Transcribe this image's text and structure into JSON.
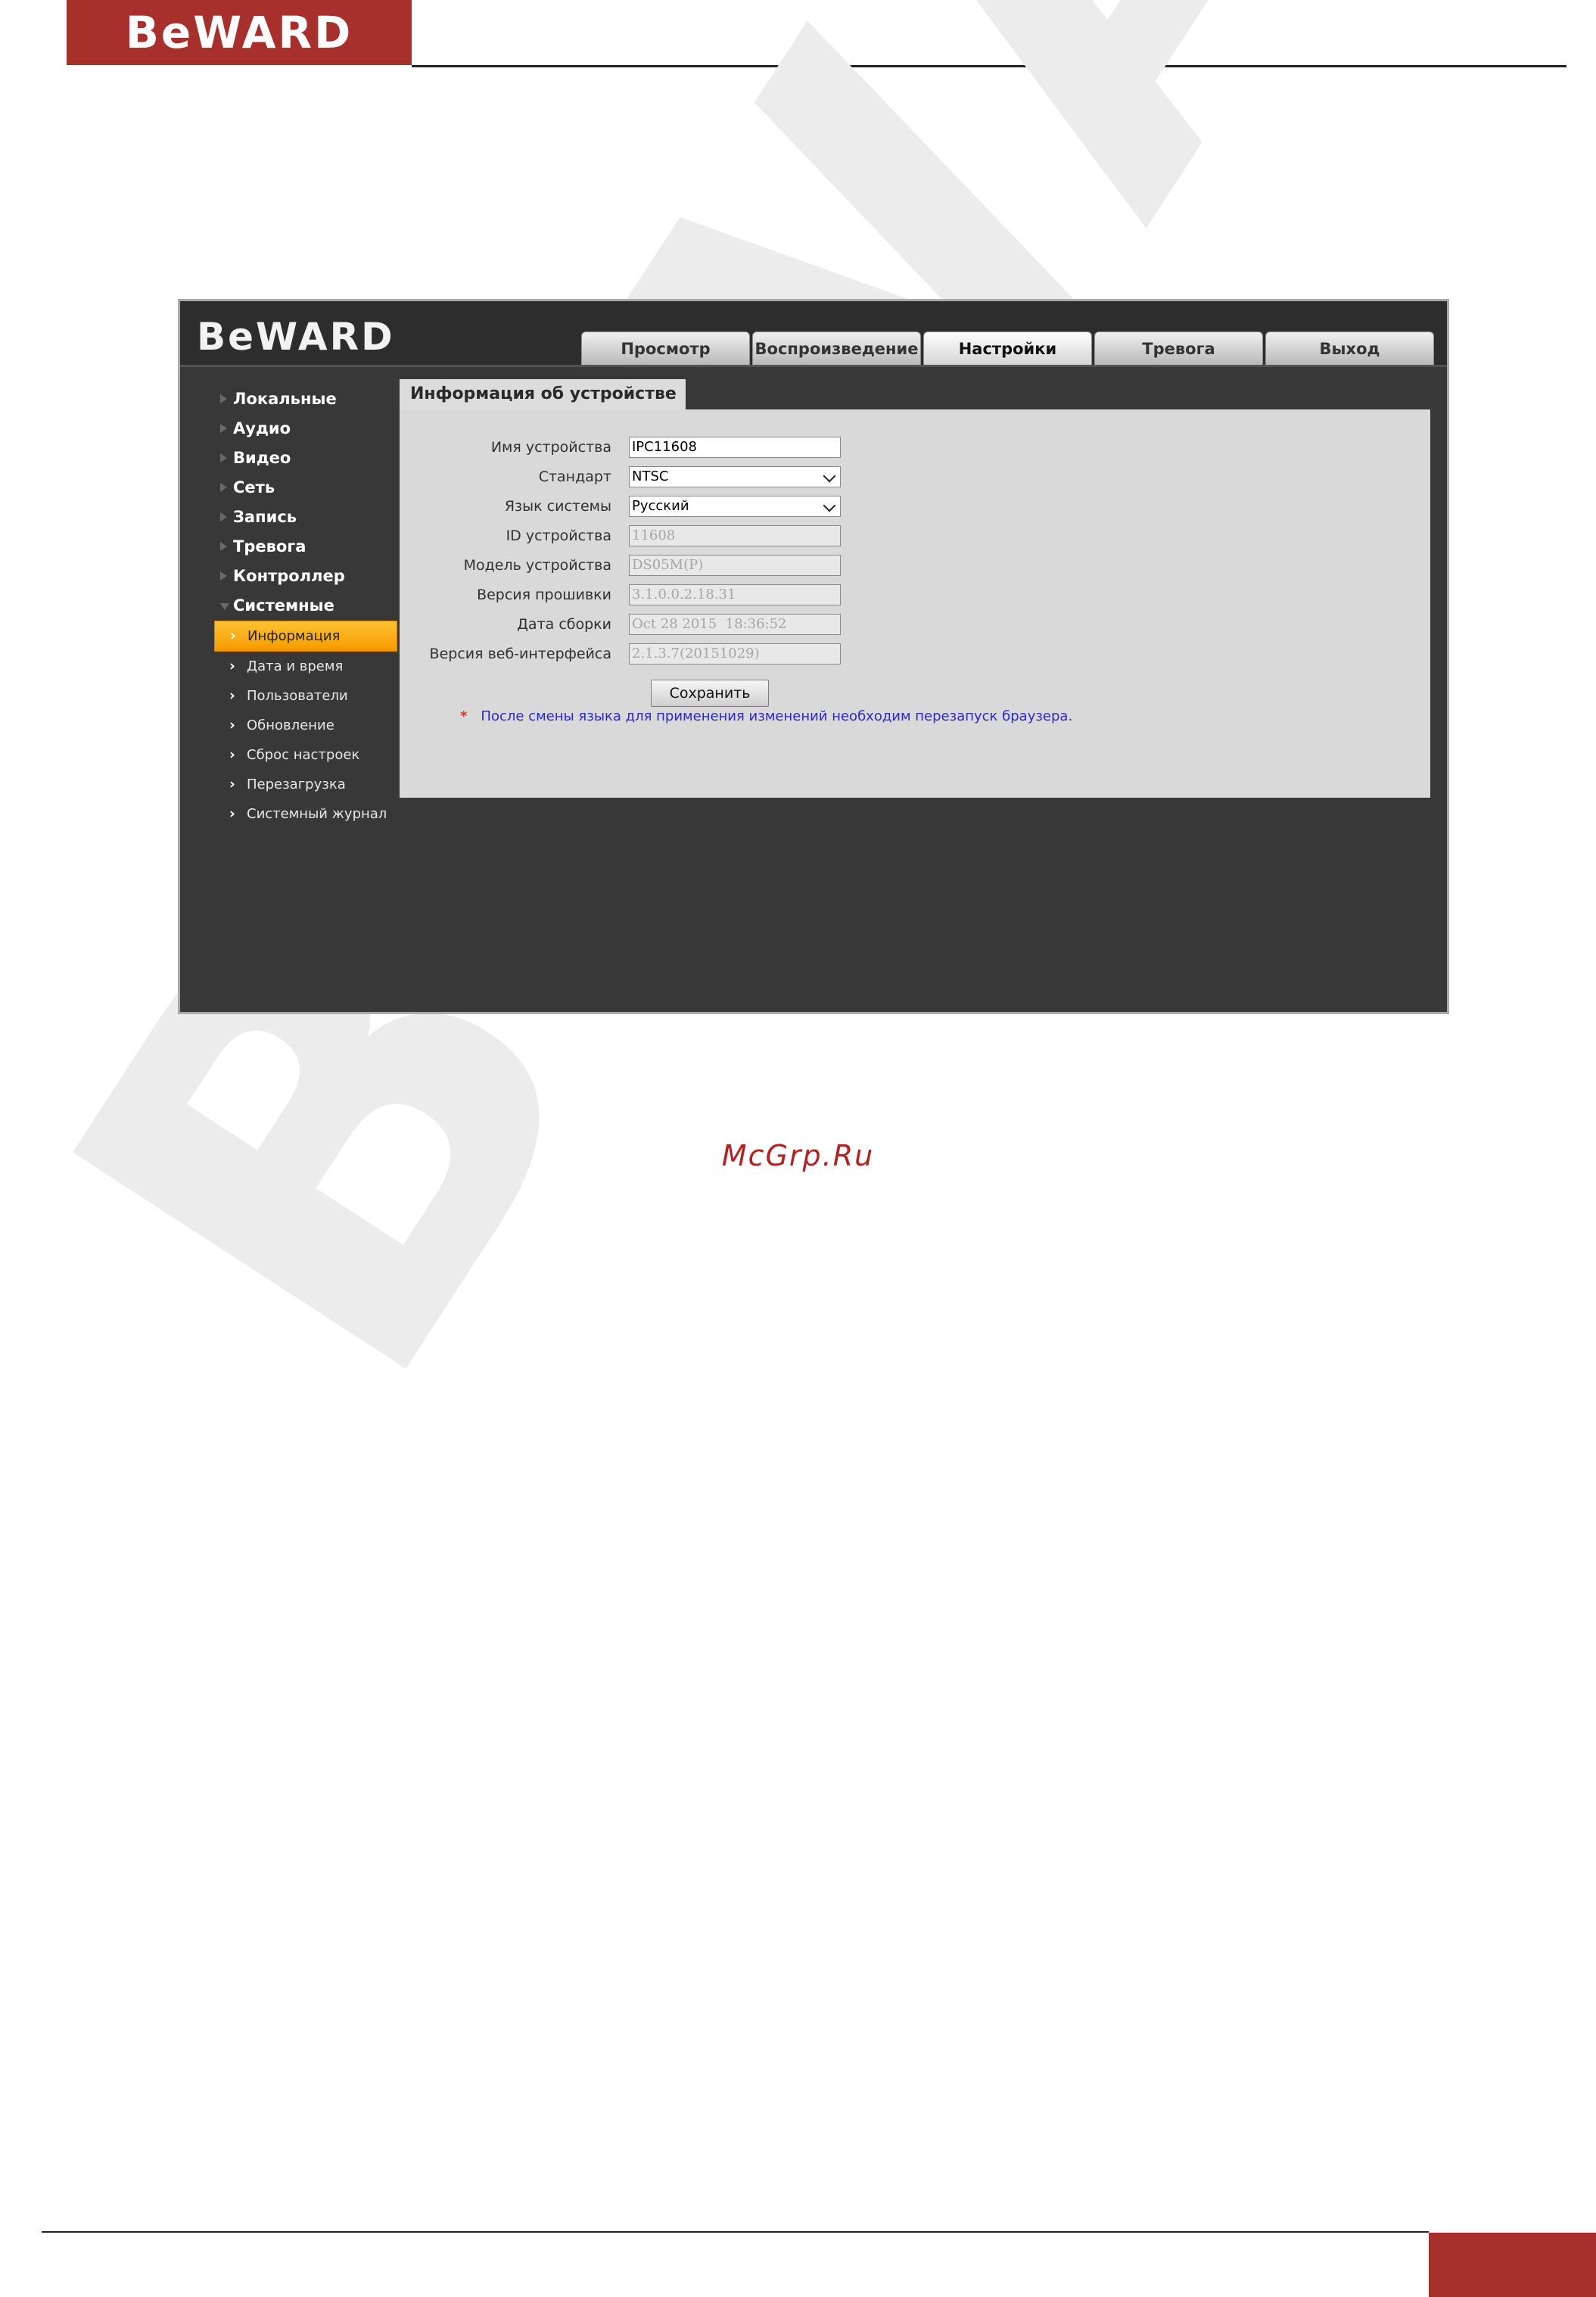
{
  "document": {
    "brand": "BeWARD",
    "watermark_site": "McGrp.Ru"
  },
  "ui": {
    "logo": "BeWARD",
    "tabs": [
      {
        "label": "Просмотр",
        "active": false
      },
      {
        "label": "Воспроизведение",
        "active": false
      },
      {
        "label": "Настройки",
        "active": true
      },
      {
        "label": "Тревога",
        "active": false
      },
      {
        "label": "Выход",
        "active": false
      }
    ],
    "sidebar": {
      "items": [
        {
          "label": "Локальные"
        },
        {
          "label": "Аудио"
        },
        {
          "label": "Видео"
        },
        {
          "label": "Сеть"
        },
        {
          "label": "Запись"
        },
        {
          "label": "Тревога"
        },
        {
          "label": "Контроллер"
        },
        {
          "label": "Системные"
        }
      ],
      "subitems": [
        {
          "label": "Информация",
          "active": true
        },
        {
          "label": "Дата и время"
        },
        {
          "label": "Пользователи"
        },
        {
          "label": "Обновление"
        },
        {
          "label": "Сброс настроек"
        },
        {
          "label": "Перезагрузка"
        },
        {
          "label": "Системный журнал"
        }
      ]
    },
    "panel": {
      "title": "Информация об устройстве",
      "fields": [
        {
          "label": "Имя устройства",
          "value": "IPC11608"
        },
        {
          "label": "Стандарт",
          "value": "NTSC"
        },
        {
          "label": "Язык системы",
          "value": "Русский"
        },
        {
          "label": "ID устройства",
          "value": "11608"
        },
        {
          "label": "Модель устройства",
          "value": "DS05M(P)"
        },
        {
          "label": "Версия прошивки",
          "value": "3.1.0.0.2.18.31"
        },
        {
          "label": "Дата сборки",
          "value": "Oct 28 2015  18:36:52"
        },
        {
          "label": "Версия веб-интерфейса",
          "value": "2.1.3.7(20151029)"
        }
      ],
      "save_label": "Сохранить",
      "note_marker": "*",
      "note": "После смены языка для применения изменений необходим перезапуск браузера."
    }
  },
  "colors": {
    "brand_red": "#a7302c",
    "ui_background": "#383838",
    "panel": "#d9d9d9",
    "active_menu": "#f59a00",
    "note_text": "#2a2acc"
  }
}
